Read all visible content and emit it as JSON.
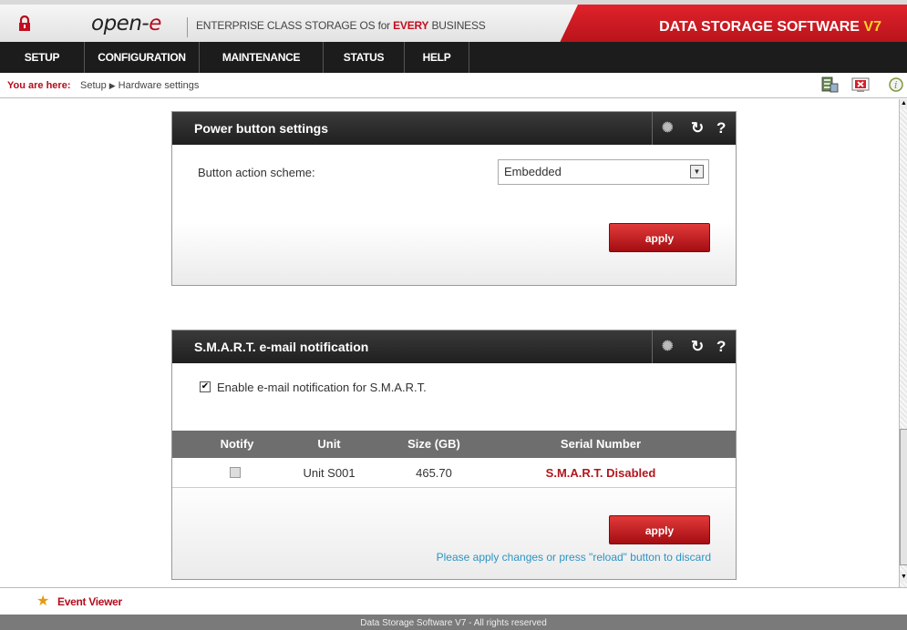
{
  "header": {
    "logo_text": "open-",
    "logo_accent": "e",
    "tagline_pre": "ENTERPRISE CLASS STORAGE OS for ",
    "tagline_accent": "EVERY",
    "tagline_post": " BUSINESS",
    "brand": "DATA STORAGE SOFTWARE ",
    "brand_version": "V7"
  },
  "nav": {
    "items": [
      {
        "label": "SETUP"
      },
      {
        "label": "CONFIGURATION"
      },
      {
        "label": "MAINTENANCE"
      },
      {
        "label": "STATUS"
      },
      {
        "label": "HELP"
      }
    ]
  },
  "breadcrumb": {
    "label": "You are here:",
    "path": [
      "Setup",
      "Hardware settings"
    ]
  },
  "toolbar_icons": [
    "server-icon",
    "close-session-icon",
    "info-icon"
  ],
  "power_panel": {
    "title": "Power button settings",
    "field_label": "Button action scheme:",
    "select_value": "Embedded",
    "apply_label": "apply"
  },
  "smart_panel": {
    "title": "S.M.A.R.T. e-mail notification",
    "enable_label": "Enable e-mail notification for S.M.A.R.T.",
    "enable_checked": true,
    "columns": [
      "Notify",
      "Unit",
      "Size (GB)",
      "Serial Number"
    ],
    "rows": [
      {
        "notify": false,
        "unit": "Unit S001",
        "size": "465.70",
        "serial": "S.M.A.R.T. Disabled"
      }
    ],
    "apply_label": "apply",
    "hint": "Please apply changes or press \"reload\" button to discard"
  },
  "event_viewer": {
    "label": "Event Viewer"
  },
  "footer": {
    "text": "Data Storage Software V7 - All rights reserved"
  },
  "colors": {
    "brand_red": "#c30d1f",
    "nav_bg": "#1c1c1c",
    "apply_red": "#c41e24",
    "hint_blue": "#2d94c3"
  }
}
